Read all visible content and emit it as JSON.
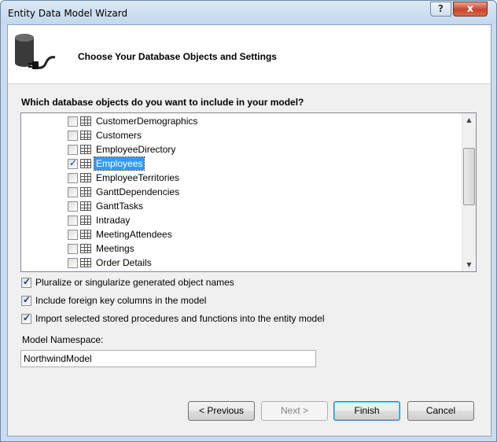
{
  "window": {
    "title": "Entity Data Model Wizard",
    "help_glyph": "?",
    "close_glyph": "x"
  },
  "header": {
    "title": "Choose Your Database Objects and Settings",
    "icon": "database-plug-icon"
  },
  "question": "Which database objects do you want to include in your model?",
  "tree": {
    "items": [
      {
        "label": "CustomerDemographics",
        "checked": false,
        "selected": false
      },
      {
        "label": "Customers",
        "checked": false,
        "selected": false
      },
      {
        "label": "EmployeeDirectory",
        "checked": false,
        "selected": false
      },
      {
        "label": "Employees",
        "checked": true,
        "selected": true
      },
      {
        "label": "EmployeeTerritories",
        "checked": false,
        "selected": false
      },
      {
        "label": "GanttDependencies",
        "checked": false,
        "selected": false
      },
      {
        "label": "GanttTasks",
        "checked": false,
        "selected": false
      },
      {
        "label": "Intraday",
        "checked": false,
        "selected": false
      },
      {
        "label": "MeetingAttendees",
        "checked": false,
        "selected": false
      },
      {
        "label": "Meetings",
        "checked": false,
        "selected": false
      },
      {
        "label": "Order Details",
        "checked": false,
        "selected": false
      }
    ]
  },
  "options": {
    "pluralize": {
      "label": "Pluralize or singularize generated object names",
      "checked": true
    },
    "foreign_keys": {
      "label": "Include foreign key columns in the model",
      "checked": true
    },
    "stored_procs": {
      "label": "Import selected stored procedures and functions into the entity model",
      "checked": true
    }
  },
  "namespace": {
    "label": "Model Namespace:",
    "value": "NorthwindModel"
  },
  "buttons": {
    "previous": "< Previous",
    "next": "Next >",
    "finish": "Finish",
    "cancel": "Cancel"
  }
}
